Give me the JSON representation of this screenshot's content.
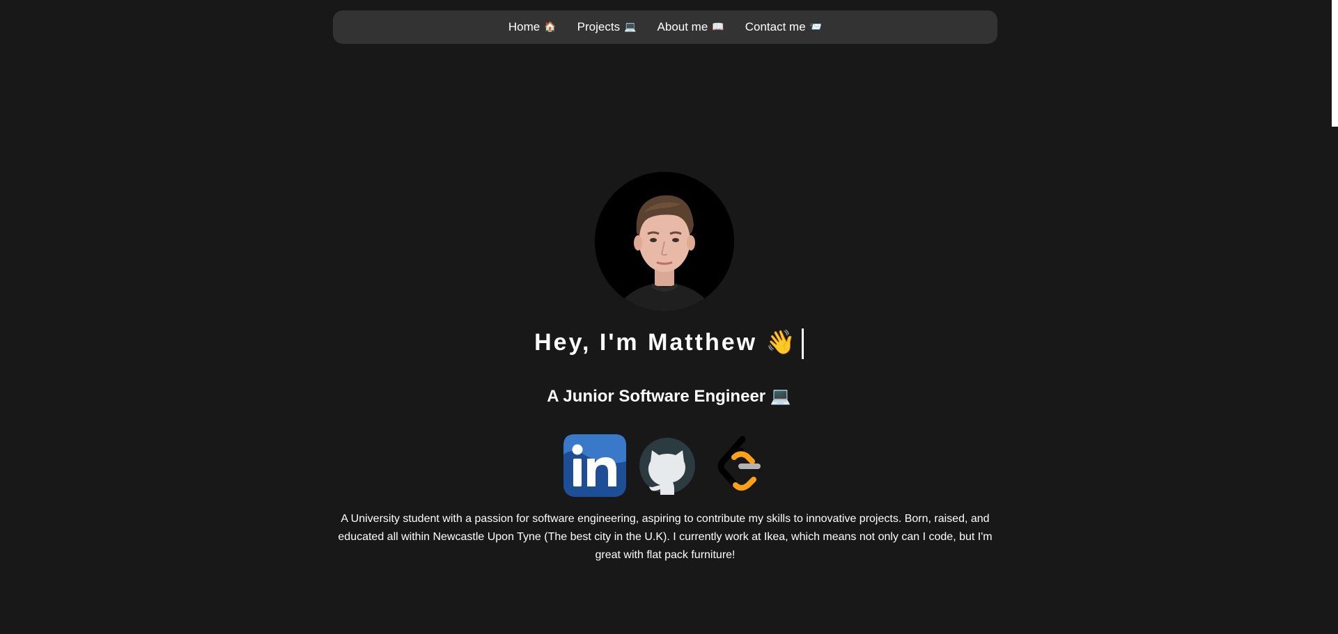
{
  "nav": {
    "items": [
      {
        "label": "Home",
        "icon": "house-icon",
        "emoji": "🏠"
      },
      {
        "label": "Projects",
        "icon": "laptop-icon",
        "emoji": "💻"
      },
      {
        "label": "About me",
        "icon": "book-icon",
        "emoji": "📖"
      },
      {
        "label": "Contact me",
        "icon": "envelope-icon",
        "emoji": "📨"
      }
    ]
  },
  "hero": {
    "greeting": "Hey, I'm Matthew 👋",
    "subtitle": "A Junior Software Engineer 💻",
    "bio": "A University student with a passion for software engineering, aspiring to contribute my skills to innovative projects. Born, raised, and educated all within Newcastle Upon Tyne (The best city in the U.K). I currently work at Ikea, which means not only can I code, but I'm great with flat pack furniture!"
  },
  "socials": [
    {
      "icon": "linkedin-icon"
    },
    {
      "icon": "github-icon"
    },
    {
      "icon": "leetcode-icon"
    }
  ],
  "colors": {
    "background": "#181818",
    "navbar": "#333333",
    "text": "#ffffff",
    "linkedin": "#2867b2",
    "github_bg": "#2c3b40",
    "leetcode_orange": "#ffa116"
  }
}
